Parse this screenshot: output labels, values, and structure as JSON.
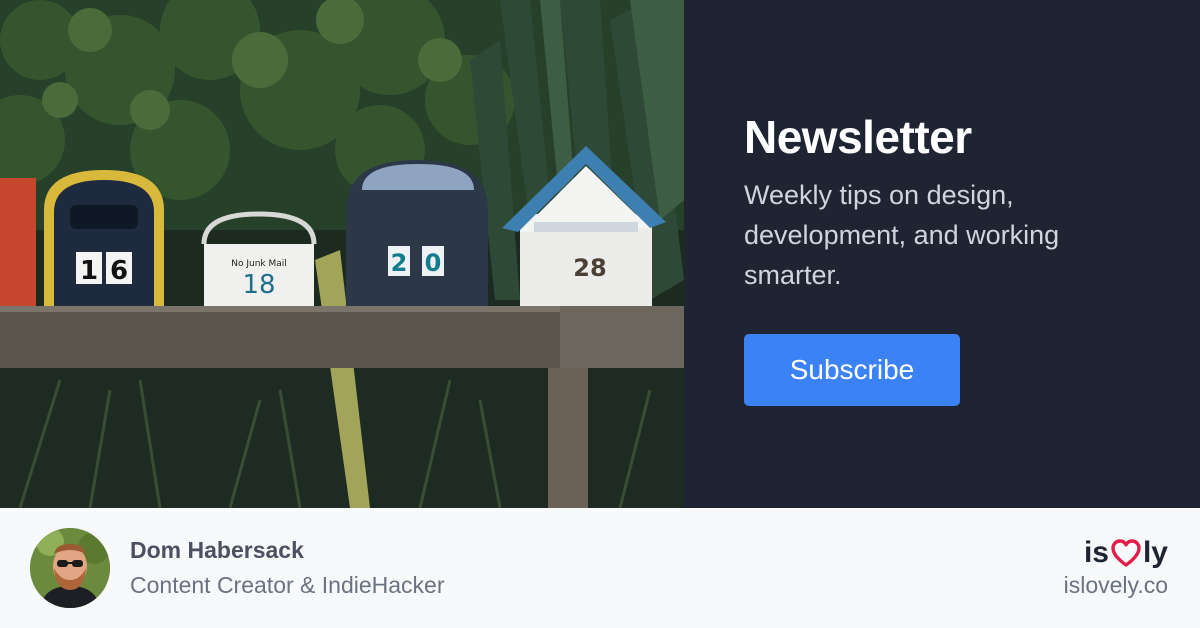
{
  "hero": {
    "title": "Newsletter",
    "description": "Weekly tips on design, development, and working smarter.",
    "subscribe_label": "Subscribe"
  },
  "photo": {
    "mailbox_numbers": [
      "16",
      "18",
      "20",
      "28"
    ],
    "sign_text": "No Junk Mail"
  },
  "author": {
    "name": "Dom Habersack",
    "role": "Content Creator & IndieHacker"
  },
  "brand": {
    "logo_left": "is",
    "logo_right": "ly",
    "website": "islovely.co"
  },
  "colors": {
    "panel_bg": "#1f2433",
    "button_bg": "#3b82f6",
    "footer_bg": "#f8f9fb",
    "heart": "#e11d48"
  },
  "icons": [
    "heart-icon"
  ]
}
